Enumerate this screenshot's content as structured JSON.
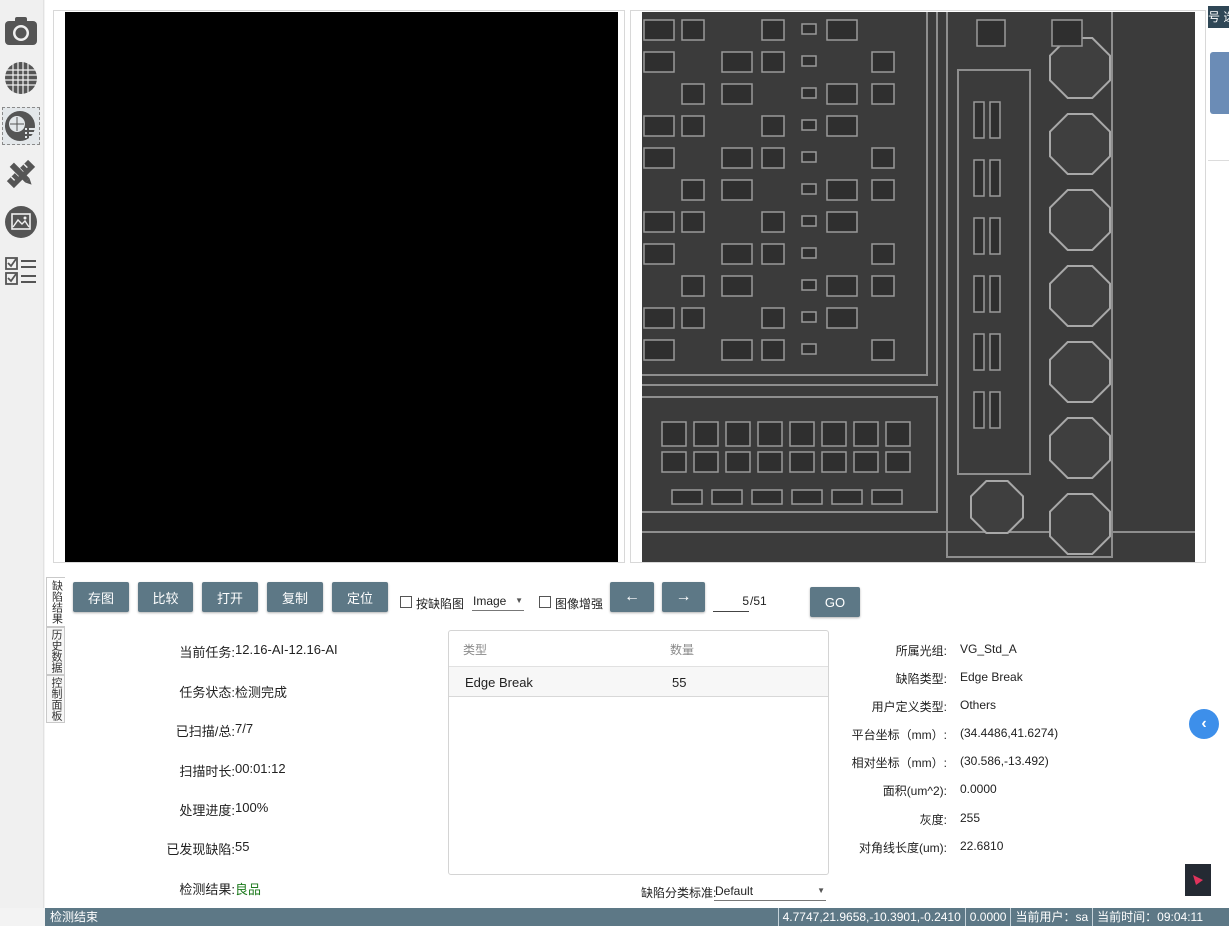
{
  "toolbar": {
    "tools": [
      {
        "icon": "camera-icon"
      },
      {
        "icon": "wafer-grid-icon"
      },
      {
        "icon": "wafer-map-list-icon",
        "active": true
      },
      {
        "icon": "ruler-pencil-icon"
      },
      {
        "icon": "image-frame-icon"
      },
      {
        "icon": "checklist-icon"
      }
    ]
  },
  "side_tabs": [
    "缺陷结果",
    "历史数据",
    "控制面板"
  ],
  "right_strip_text": "号 选",
  "controls": {
    "save_image": "存图",
    "compare": "比较",
    "open": "打开",
    "copy": "复制",
    "locate": "定位",
    "by_defect_image": "按缺陷图",
    "image_select": "Image",
    "image_enhance": "图像增强",
    "prev": "←",
    "next": "→",
    "page_current": "5",
    "page_total": "/51",
    "go": "GO"
  },
  "task_info": {
    "current_task_label": "当前任务:",
    "current_task": "12.16-AI-12.16-AI",
    "status_label": "任务状态:",
    "status": "检测完成",
    "scanned_label": "已扫描/总:",
    "scanned": "7/7",
    "duration_label": "扫描时长:",
    "duration": "00:01:12",
    "progress_label": "处理进度:",
    "progress": "100%",
    "defects_found_label": "已发现缺陷:",
    "defects_found": "55",
    "result_label": "检测结果:",
    "result": "良品"
  },
  "defect_table": {
    "headers": [
      "类型",
      "数量"
    ],
    "rows": [
      {
        "type": "Edge Break",
        "count": "55"
      }
    ]
  },
  "classification": {
    "label": "缺陷分类标准:",
    "value": "Default"
  },
  "defect_info": {
    "group_label": "所属光组:",
    "group": "VG_Std_A",
    "type_label": "缺陷类型:",
    "type": "Edge Break",
    "user_type_label": "用户定义类型:",
    "user_type": "Others",
    "stage_coord_label": "平台坐标（mm）:",
    "stage_coord": "(34.4486,41.6274)",
    "rel_coord_label": "相对坐标（mm）:",
    "rel_coord": "(30.586,-13.492)",
    "area_label": "面积(um^2):",
    "area": "0.0000",
    "gray_label": "灰度:",
    "gray": "255",
    "diag_label": "对角线长度(um):",
    "diag": "22.6810"
  },
  "status_bar": {
    "left": "检测结束",
    "coords": "4.7747,21.9658,-10.3901,-0.2410",
    "value": "0.0000",
    "user": "当前用户：sa",
    "time": "当前时间：09:04:11"
  },
  "colors": {
    "button": "#5d7886",
    "status_bar": "#5d7886",
    "good_result": "#1c7a1c",
    "accent_blue": "#3d8fea"
  }
}
